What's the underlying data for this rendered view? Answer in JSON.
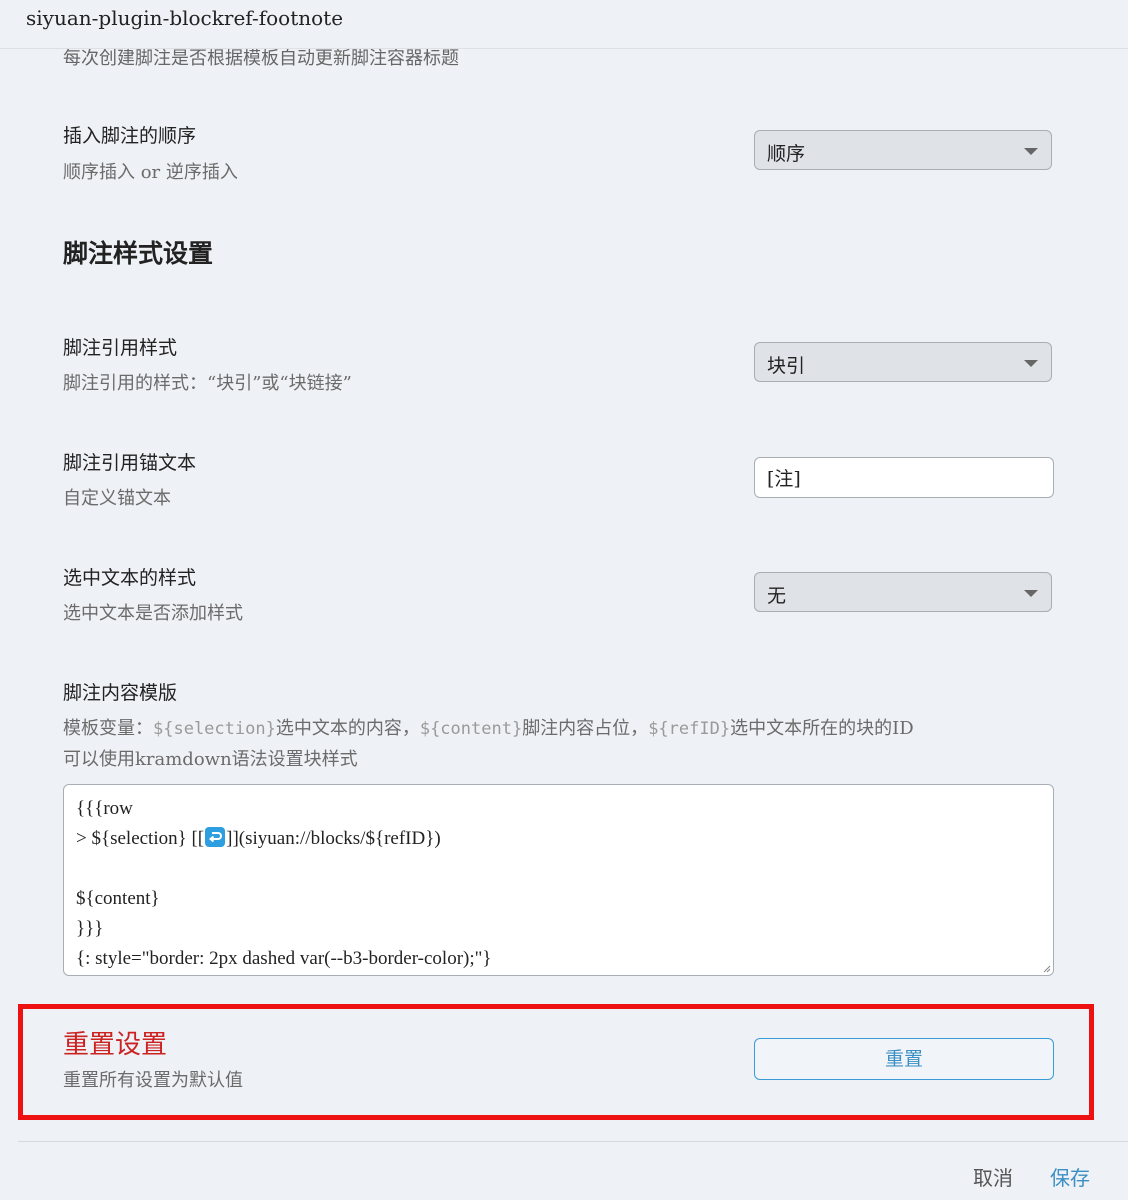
{
  "window": {
    "title": "siyuan-plugin-blockref-footnote"
  },
  "settings": {
    "previous_desc": "每次创建脚注是否根据模板自动更新脚注容器标题",
    "insert_order": {
      "label": "插入脚注的顺序",
      "desc": "顺序插入 or 逆序插入",
      "value": "顺序"
    },
    "style_section_title": "脚注样式设置",
    "ref_style": {
      "label": "脚注引用样式",
      "desc": "脚注引用的样式：“块引”或“块链接”",
      "value": "块引"
    },
    "anchor_text": {
      "label": "脚注引用锚文本",
      "desc": "自定义锚文本",
      "value": "[注]"
    },
    "selection_style": {
      "label": "选中文本的样式",
      "desc": "选中文本是否添加样式",
      "value": "无"
    },
    "content_template": {
      "label": "脚注内容模版",
      "desc_prefix": "模板变量：",
      "var_selection": "${selection}",
      "desc_mid1": "选中文本的内容，",
      "var_content": "${content}",
      "desc_mid2": "脚注内容占位，",
      "var_refid": "${refID}",
      "desc_end": "选中文本所在的块的ID",
      "desc_line2": "可以使用kramdown语法设置块样式",
      "template_lines": {
        "line1": "{{{row",
        "line2_before_icon": "> ${selection} [[",
        "line2_after_icon": "]](siyuan://blocks/${refID})",
        "line3": "",
        "line4": "${content}",
        "line5": "}}}",
        "line6": "{: style=\"border: 2px dashed var(--b3-border-color);\"}"
      }
    },
    "reset": {
      "label": "重置设置",
      "desc": "重置所有设置为默认值",
      "button_label": "重置"
    }
  },
  "footer": {
    "cancel_label": "取消",
    "save_label": "保存"
  },
  "colors": {
    "accent": "#3b8fc4",
    "danger": "#cc2222",
    "highlight_frame": "#ee1111",
    "background": "#eef1f5"
  }
}
